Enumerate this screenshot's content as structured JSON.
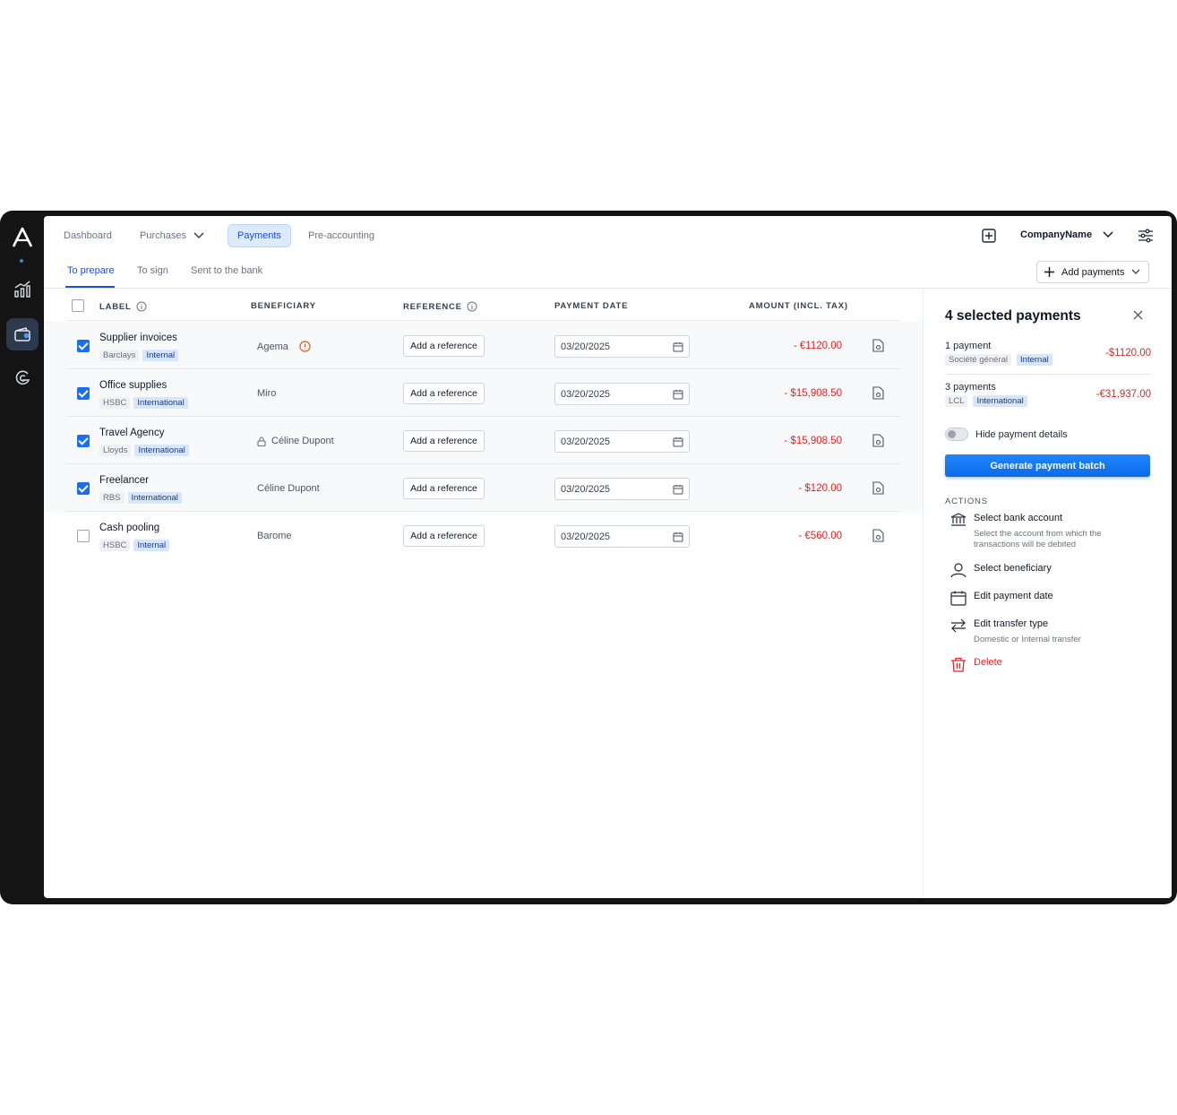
{
  "nav": {
    "items": [
      {
        "label": "Dashboard"
      },
      {
        "label": "Purchases"
      },
      {
        "label": "Payments"
      },
      {
        "label": "Pre-accounting"
      }
    ],
    "company": "CompanyName"
  },
  "subtabs": [
    "To prepare",
    "To sign",
    "Sent to the bank"
  ],
  "add_payments": "Add payments",
  "table": {
    "headers": {
      "label": "LABEL",
      "beneficiary": "BENEFICIARY",
      "reference": "REFERENCE",
      "payment_date": "PAYMENT DATE",
      "amount": "AMOUNT (INCL. TAX)"
    },
    "rows": [
      {
        "label": "Supplier invoices",
        "bank": "Barclays",
        "type": "Internal",
        "beneficiary": "Agema",
        "warning": true,
        "reference_btn": "Add a reference",
        "date": "03/20/2025",
        "amount": "- €1120.00",
        "checked": true
      },
      {
        "label": "Office supplies",
        "bank": "HSBC",
        "type": "International",
        "beneficiary": "Miro",
        "reference_btn": "Add a reference",
        "date": "03/20/2025",
        "amount": "- $15,908.50",
        "checked": true
      },
      {
        "label": "Travel Agency",
        "bank": "Lloyds",
        "type": "International",
        "beneficiary": "Céline Dupont",
        "locked": true,
        "reference_btn": "Add a reference",
        "date": "03/20/2025",
        "amount": "- $15,908.50",
        "checked": true
      },
      {
        "label": "Freelancer",
        "bank": "RBS",
        "type": "International",
        "beneficiary": "Céline Dupont",
        "reference_btn": "Add a reference",
        "date": "03/20/2025",
        "amount": "- $120.00",
        "checked": true
      },
      {
        "label": "Cash pooling",
        "bank": "HSBC",
        "type": "Internal",
        "beneficiary": "Barome",
        "reference_btn": "Add a reference",
        "date": "03/20/2025",
        "amount": "- €560.00",
        "checked": false
      }
    ]
  },
  "panel": {
    "title": "4 selected payments",
    "summaries": [
      {
        "count": "1 payment",
        "bank": "Société général",
        "type": "Internal",
        "amount": "-$1120.00"
      },
      {
        "count": "3 payments",
        "bank": "LCL",
        "type": "International",
        "amount": "-€31,937.00"
      }
    ],
    "toggle_label": "Hide payment details",
    "generate": "Generate payment batch",
    "actions_heading": "ACTIONS",
    "actions": [
      {
        "label": "Select bank account",
        "sub": "Select the account from which the transactions will be debited",
        "icon": "bank-icon"
      },
      {
        "label": "Select beneficiary",
        "icon": "user-icon"
      },
      {
        "label": "Edit payment date",
        "icon": "calendar-icon"
      },
      {
        "label": "Edit transfer type",
        "sub": "Domestic or Internal transfer",
        "icon": "swap-icon"
      },
      {
        "label": "Delete",
        "icon": "trash-icon"
      }
    ]
  },
  "colors": {
    "accent": "#1a6ff0",
    "negative": "#dc2626",
    "rail": "#141414"
  }
}
